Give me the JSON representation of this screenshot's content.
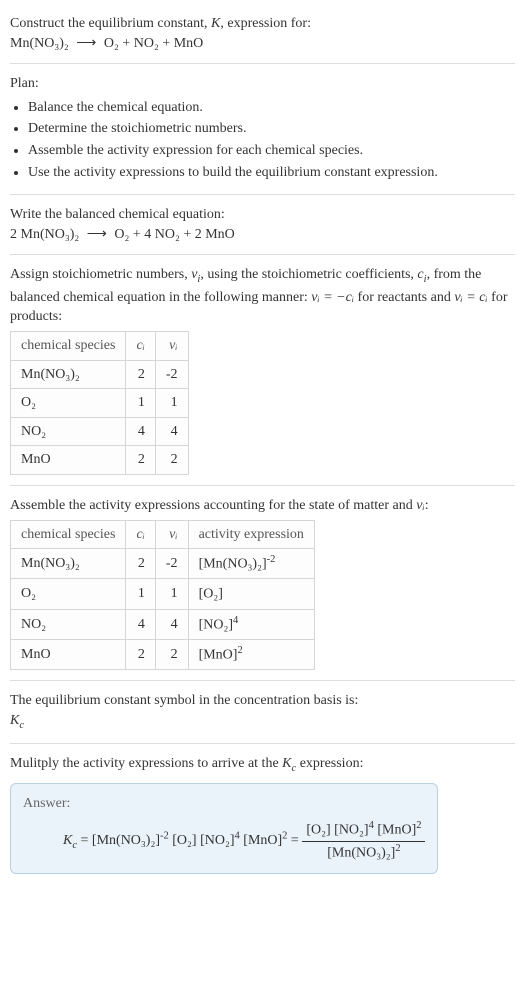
{
  "prompt": {
    "line1": "Construct the equilibrium constant, K, expression for:",
    "equation_lhs": "Mn(NO₃)₂",
    "arrow": "⟶",
    "equation_rhs": "O₂ + NO₂ + MnO"
  },
  "plan": {
    "label": "Plan:",
    "items": [
      "Balance the chemical equation.",
      "Determine the stoichiometric numbers.",
      "Assemble the activity expression for each chemical species.",
      "Use the activity expressions to build the equilibrium constant expression."
    ]
  },
  "balanced": {
    "intro": "Write the balanced chemical equation:",
    "lhs": "2 Mn(NO₃)₂",
    "arrow": "⟶",
    "rhs": "O₂ + 4 NO₂ + 2 MnO"
  },
  "assign": {
    "intro_a": "Assign stoichiometric numbers, ",
    "nu": "ν",
    "sub_i": "i",
    "intro_b": ", using the stoichiometric coefficients, ",
    "c": "c",
    "intro_c": ", from the balanced chemical equation in the following manner: ",
    "rel1": "νᵢ = −cᵢ",
    "rel1_tail": " for reactants and ",
    "rel2": "νᵢ = cᵢ",
    "rel2_tail": " for products:"
  },
  "table1": {
    "headers": {
      "species": "chemical species",
      "c": "cᵢ",
      "nu": "νᵢ"
    },
    "rows": [
      {
        "species": "Mn(NO₃)₂",
        "c": "2",
        "nu": "-2"
      },
      {
        "species": "O₂",
        "c": "1",
        "nu": "1"
      },
      {
        "species": "NO₂",
        "c": "4",
        "nu": "4"
      },
      {
        "species": "MnO",
        "c": "2",
        "nu": "2"
      }
    ]
  },
  "assemble": {
    "intro_a": "Assemble the activity expressions accounting for the state of matter and ",
    "nu": "νᵢ",
    "intro_b": ":"
  },
  "table2": {
    "headers": {
      "species": "chemical species",
      "c": "cᵢ",
      "nu": "νᵢ",
      "act": "activity expression"
    },
    "rows": [
      {
        "species": "Mn(NO₃)₂",
        "c": "2",
        "nu": "-2",
        "act_base": "[Mn(NO₃)₂]",
        "act_exp": "-2"
      },
      {
        "species": "O₂",
        "c": "1",
        "nu": "1",
        "act_base": "[O₂]",
        "act_exp": ""
      },
      {
        "species": "NO₂",
        "c": "4",
        "nu": "4",
        "act_base": "[NO₂]",
        "act_exp": "4"
      },
      {
        "species": "MnO",
        "c": "2",
        "nu": "2",
        "act_base": "[MnO]",
        "act_exp": "2"
      }
    ]
  },
  "basis": {
    "line": "The equilibrium constant symbol in the concentration basis is:",
    "symbol_base": "K",
    "symbol_sub": "c"
  },
  "multiply": {
    "intro_a": "Mulitply the activity expressions to arrive at the ",
    "kc_base": "K",
    "kc_sub": "c",
    "intro_b": " expression:"
  },
  "answer": {
    "label": "Answer:",
    "kc_base": "K",
    "kc_sub": "c",
    "eq": " = ",
    "flat_parts": {
      "p1": "[Mn(NO₃)₂]",
      "e1": "-2",
      "sp1": " ",
      "p2": "[O₂]",
      "sp2": " ",
      "p3": "[NO₂]",
      "e3": "4",
      "sp3": " ",
      "p4": "[MnO]",
      "e4": "2"
    },
    "eq2": " = ",
    "frac": {
      "num_p1": "[O₂]",
      "num_sp1": " ",
      "num_p2": "[NO₂]",
      "num_e2": "4",
      "num_sp2": " ",
      "num_p3": "[MnO]",
      "num_e3": "2",
      "den_p1": "[Mn(NO₃)₂]",
      "den_e1": "2"
    }
  }
}
